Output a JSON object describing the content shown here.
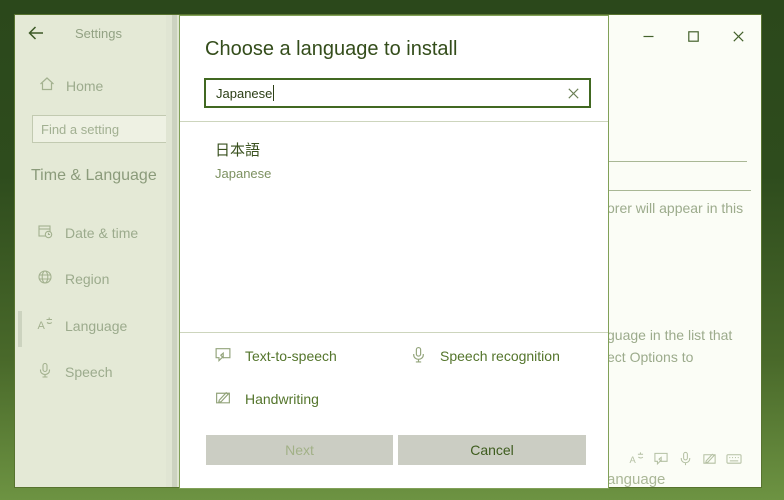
{
  "colors": {
    "accent_green": "#416821",
    "desktop_dark": "#2b481b",
    "desktop_olive": "#6d9342",
    "dialog_border": "#81a058",
    "button_gray": "#cbcdc3"
  },
  "titlebar": {
    "title": "Settings"
  },
  "sidebar": {
    "home_label": "Home",
    "search_placeholder": "Find a setting",
    "section_title": "Time & Language",
    "items": [
      {
        "label": "Date & time"
      },
      {
        "label": "Region"
      },
      {
        "label": "Language"
      },
      {
        "label": "Speech"
      }
    ]
  },
  "background_page": {
    "fragment_display_language": "orer will appear in this",
    "fragment_preferred_1": "guage in the list that",
    "fragment_preferred_2": "ect Options to",
    "fragment_language_name": "anguage"
  },
  "dialog": {
    "title": "Choose a language to install",
    "search_value": "Japanese",
    "result": {
      "native": "日本語",
      "english": "Japanese"
    },
    "features": [
      {
        "label": "Text-to-speech"
      },
      {
        "label": "Speech recognition"
      },
      {
        "label": "Handwriting"
      }
    ],
    "next_label": "Next",
    "cancel_label": "Cancel"
  }
}
